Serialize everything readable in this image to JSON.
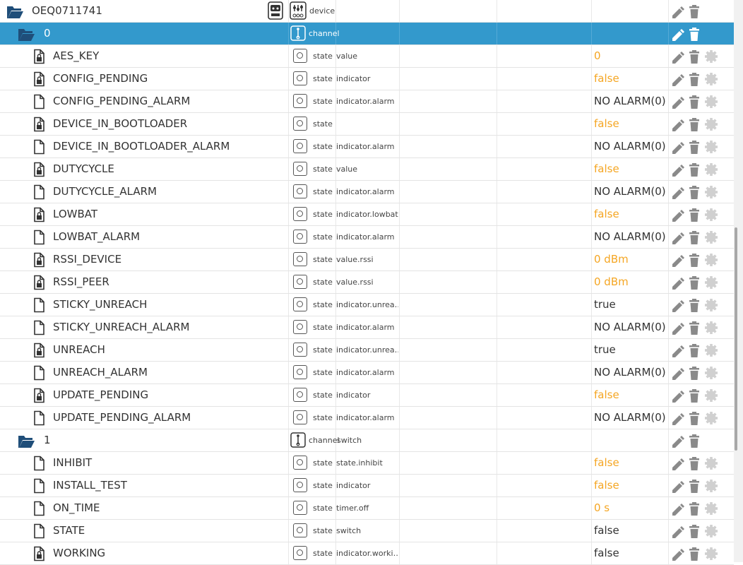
{
  "colors": {
    "accent": "#3399cc",
    "value_orange": "#f5a623",
    "text": "#333333"
  },
  "icons": {
    "folder": "folder-open-icon",
    "state_locked": "file-lock-icon",
    "state": "file-icon",
    "edit": "pencil-icon",
    "delete": "trash-icon",
    "settings": "gear-icon",
    "device_type": "device-icon",
    "channel_type": "channel-icon",
    "state_type": "state-icon"
  },
  "rows": [
    {
      "kind": "device",
      "name": "OEQ0711741",
      "type": "device",
      "role": "",
      "value": ""
    },
    {
      "kind": "channel",
      "name": "0",
      "type": "channel",
      "role": "",
      "value": "",
      "selected": true
    },
    {
      "kind": "state",
      "locked": true,
      "name": "AES_KEY",
      "type": "state",
      "role": "value",
      "value": "0",
      "value_color": "orange"
    },
    {
      "kind": "state",
      "locked": true,
      "name": "CONFIG_PENDING",
      "type": "state",
      "role": "indicator",
      "value": "false",
      "value_color": "orange"
    },
    {
      "kind": "state",
      "locked": false,
      "name": "CONFIG_PENDING_ALARM",
      "type": "state",
      "role": "indicator.alarm",
      "value": "NO ALARM(0)",
      "value_color": "black"
    },
    {
      "kind": "state",
      "locked": true,
      "name": "DEVICE_IN_BOOTLOADER",
      "type": "state",
      "role": "",
      "value": "false",
      "value_color": "orange"
    },
    {
      "kind": "state",
      "locked": false,
      "name": "DEVICE_IN_BOOTLOADER_ALARM",
      "type": "state",
      "role": "indicator.alarm",
      "value": "NO ALARM(0)",
      "value_color": "black"
    },
    {
      "kind": "state",
      "locked": true,
      "name": "DUTYCYCLE",
      "type": "state",
      "role": "value",
      "value": "false",
      "value_color": "orange"
    },
    {
      "kind": "state",
      "locked": false,
      "name": "DUTYCYCLE_ALARM",
      "type": "state",
      "role": "indicator.alarm",
      "value": "NO ALARM(0)",
      "value_color": "black"
    },
    {
      "kind": "state",
      "locked": true,
      "name": "LOWBAT",
      "type": "state",
      "role": "indicator.lowbat",
      "value": "false",
      "value_color": "orange"
    },
    {
      "kind": "state",
      "locked": false,
      "name": "LOWBAT_ALARM",
      "type": "state",
      "role": "indicator.alarm",
      "value": "NO ALARM(0)",
      "value_color": "black"
    },
    {
      "kind": "state",
      "locked": true,
      "name": "RSSI_DEVICE",
      "type": "state",
      "role": "value.rssi",
      "value": "0 dBm",
      "value_color": "orange"
    },
    {
      "kind": "state",
      "locked": true,
      "name": "RSSI_PEER",
      "type": "state",
      "role": "value.rssi",
      "value": "0 dBm",
      "value_color": "orange"
    },
    {
      "kind": "state",
      "locked": false,
      "name": "STICKY_UNREACH",
      "type": "state",
      "role": "indicator.unrea…",
      "value": "true",
      "value_color": "black"
    },
    {
      "kind": "state",
      "locked": false,
      "name": "STICKY_UNREACH_ALARM",
      "type": "state",
      "role": "indicator.alarm",
      "value": "NO ALARM(0)",
      "value_color": "black"
    },
    {
      "kind": "state",
      "locked": true,
      "name": "UNREACH",
      "type": "state",
      "role": "indicator.unrea…",
      "value": "true",
      "value_color": "black"
    },
    {
      "kind": "state",
      "locked": false,
      "name": "UNREACH_ALARM",
      "type": "state",
      "role": "indicator.alarm",
      "value": "NO ALARM(0)",
      "value_color": "black"
    },
    {
      "kind": "state",
      "locked": true,
      "name": "UPDATE_PENDING",
      "type": "state",
      "role": "indicator",
      "value": "false",
      "value_color": "orange"
    },
    {
      "kind": "state",
      "locked": false,
      "name": "UPDATE_PENDING_ALARM",
      "type": "state",
      "role": "indicator.alarm",
      "value": "NO ALARM(0)",
      "value_color": "black"
    },
    {
      "kind": "channel",
      "name": "1",
      "type": "channel",
      "role": "switch",
      "value": ""
    },
    {
      "kind": "state",
      "locked": false,
      "name": "INHIBIT",
      "type": "state",
      "role": "state.inhibit",
      "value": "false",
      "value_color": "orange"
    },
    {
      "kind": "state",
      "locked": false,
      "name": "INSTALL_TEST",
      "type": "state",
      "role": "indicator",
      "value": "false",
      "value_color": "orange"
    },
    {
      "kind": "state",
      "locked": false,
      "name": "ON_TIME",
      "type": "state",
      "role": "timer.off",
      "value": "0 s",
      "value_color": "orange"
    },
    {
      "kind": "state",
      "locked": false,
      "name": "STATE",
      "type": "state",
      "role": "switch",
      "value": "false",
      "value_color": "black"
    },
    {
      "kind": "state",
      "locked": true,
      "name": "WORKING",
      "type": "state",
      "role": "indicator.worki…",
      "value": "false",
      "value_color": "black"
    }
  ]
}
